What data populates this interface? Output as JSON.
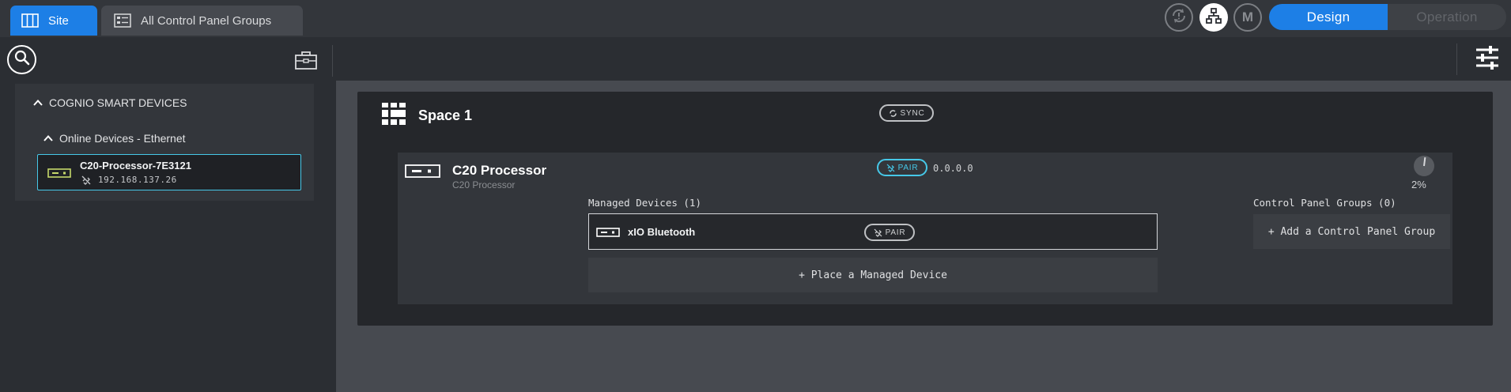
{
  "tabs": {
    "site": "Site",
    "control_panel_groups": "All Control Panel Groups"
  },
  "header": {
    "icons": [
      "sync-alert-icon",
      "network-icon",
      "m-icon"
    ],
    "m_label": "M",
    "mode": {
      "design": "Design",
      "operation": "Operation",
      "selected": "Design"
    }
  },
  "sidebar": {
    "icons": [
      "search-icon",
      "toolbox-icon"
    ],
    "tree": {
      "group": "COGNIO SMART DEVICES",
      "subgroup": "Online Devices - Ethernet",
      "device": {
        "name": "C20-Processor-7E3121",
        "ip": "192.168.137.26"
      }
    }
  },
  "main": {
    "space": {
      "title": "Space 1",
      "sync_label": "SYNC",
      "processor": {
        "title": "C20 Processor",
        "subtitle": "C20 Processor",
        "pair_label": "PAIR",
        "ip": "0.0.0.0",
        "progress_label": "2%",
        "progress_value": 2,
        "managed_label": "Managed Devices (1)",
        "managed_devices": [
          {
            "name": "xIO Bluetooth",
            "pair_label": "PAIR"
          }
        ],
        "place_label": "+ Place a Managed Device",
        "cpg_label": "Control Panel Groups (0)",
        "add_cpg_label": "+ Add a Control Panel Group"
      }
    }
  },
  "colors": {
    "accent": "#1d7fe6",
    "pair": "#46c8e8",
    "device_icon": "#c6d86a"
  }
}
